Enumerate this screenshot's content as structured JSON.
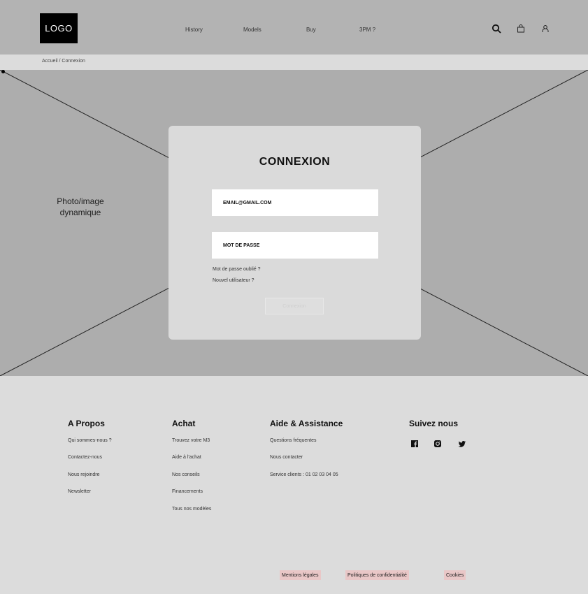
{
  "header": {
    "logo": "LOGO",
    "nav": [
      "History",
      "Models",
      "Buy",
      "3PM ?"
    ],
    "icons": [
      "search-icon",
      "bag-icon",
      "user-icon"
    ]
  },
  "breadcrumb": "Accueil / Connexion",
  "hero": {
    "caption_line1": "Photo/image",
    "caption_line2": "dynamique"
  },
  "login": {
    "title": "CONNEXION",
    "email_placeholder": "EMAIL@GMAIL.COM",
    "password_placeholder": "MOT DE PASSE",
    "forgot_password": "Mot de passe oublié ?",
    "new_user": "Nouvel utilisateur ?",
    "submit": "Connexion"
  },
  "footer": {
    "columns": [
      {
        "title": "A Propos",
        "links": [
          "Qui sommes-nous ?",
          "Contactez-nous",
          "Nous rejoindre",
          "Newsletter"
        ]
      },
      {
        "title": "Achat",
        "links": [
          "Trouvez votre M3",
          "Aide à l'achat",
          "Nos conseils",
          "Financements",
          "Tous nos modèles"
        ]
      },
      {
        "title": "Aide & Assistance",
        "links": [
          "Questions fréquentes",
          "Nous contacter",
          "Service clients : 01 02 03 04 05"
        ]
      },
      {
        "title": "Suivez nous",
        "social": [
          "facebook-icon",
          "instagram-icon",
          "twitter-icon"
        ]
      }
    ],
    "legal": [
      "Mentions légales",
      "Politiques de confidentialité",
      "Cookies"
    ]
  },
  "colors": {
    "header_bg": "#b3b3b3",
    "hero_bg": "#adadad",
    "card_bg": "#dadada",
    "page_bg": "#dcdcdc",
    "legal_highlight": "#e9c7c7"
  }
}
